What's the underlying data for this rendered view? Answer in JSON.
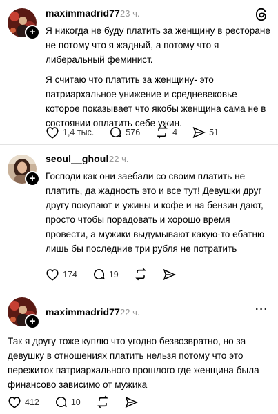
{
  "posts": [
    {
      "username": "maximmadrid77",
      "time": "23 ч.",
      "paragraphs": [
        "Я никогда не буду платить за женщину в ресторане не потому что я жадный, а потому что я либеральный феминист.",
        "Я считаю что платить за женщину- это патриархальное унижение и средневековье которое показывает что якобы женщина сама не в состоянии оплатить себе ужин."
      ],
      "likes": "1,4 тыс.",
      "comments": "576",
      "reposts": "4",
      "shares": "51"
    },
    {
      "username": "seoul__ghoul",
      "time": "22 ч.",
      "paragraphs": [
        "Господи как они заебали со своим платить не платить, да жадность это и все тут! Девушки друг другу покупают и ужины и кофе и на бензин дают, просто чтобы порадовать и хорошо время провести, а мужики выдумывают какую-то ебатню лишь бы последние три  рубля не потратить"
      ],
      "likes": "174",
      "comments": "19"
    },
    {
      "username": "maximmadrid77",
      "time": "22 ч.",
      "paragraphs": [
        "Так я другу тоже куплю что угодно безвозвратно, но за девушку в отношениях платить нельзя потому что это пережиток патриархального прошлого где женщина была финансово зависимо от мужика"
      ],
      "likes": "412",
      "comments": "10"
    }
  ],
  "icons": {
    "app": "threads-logo-icon",
    "more": "more-options-icon",
    "like": "heart-icon",
    "comment": "comment-icon",
    "repost": "repost-icon",
    "share": "share-icon"
  }
}
